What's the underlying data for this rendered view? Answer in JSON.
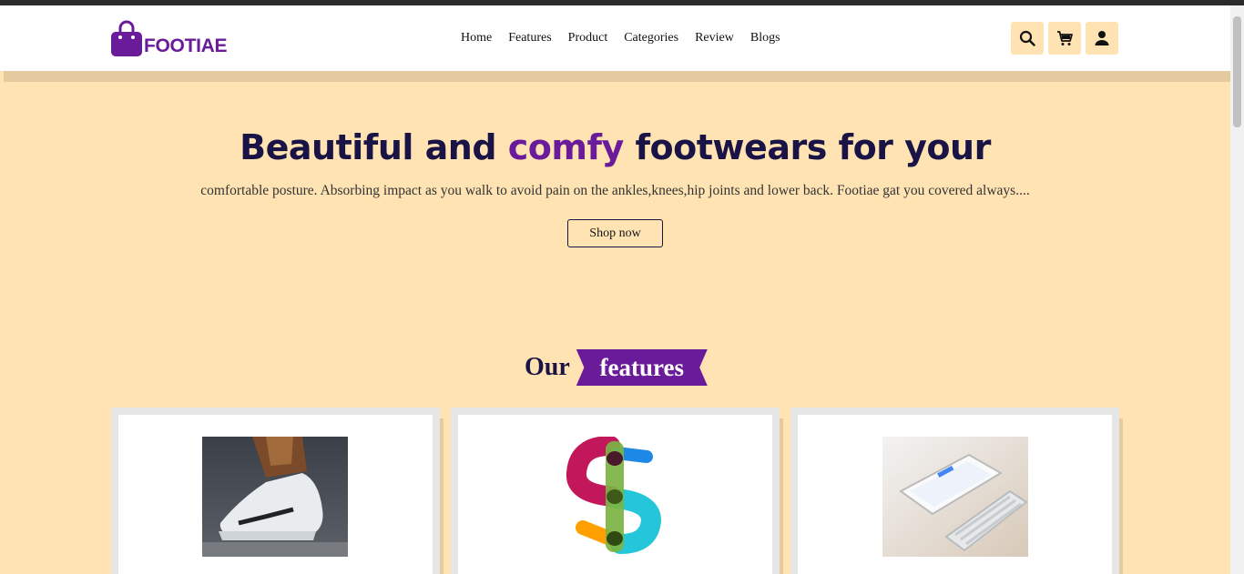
{
  "brand": {
    "name": "FOOTIAE",
    "color": "#6a1b9a"
  },
  "nav": {
    "items": [
      "Home",
      "Features",
      "Product",
      "Categories",
      "Review",
      "Blogs"
    ]
  },
  "header_icons": [
    "search-icon",
    "cart-icon",
    "user-icon"
  ],
  "hero": {
    "title_part1": "Beautiful and ",
    "title_accent": "comfy",
    "title_part2": " footwears for your",
    "subtitle": "comfortable posture. Absorbing impact as you walk to avoid pain on the ankles,knees,hip joints and lower back. Footiae gat you covered always....",
    "cta": "Shop now"
  },
  "features": {
    "heading_plain": "Our",
    "heading_ribbon": "features",
    "cards": [
      {
        "image": "sneaker-photo"
      },
      {
        "image": "dollar-sign-graphic"
      },
      {
        "image": "tablet-keyboard-photo"
      }
    ]
  },
  "colors": {
    "background": "#ffe3b3",
    "heading": "#1a1446",
    "accent": "#6a1b9a"
  }
}
